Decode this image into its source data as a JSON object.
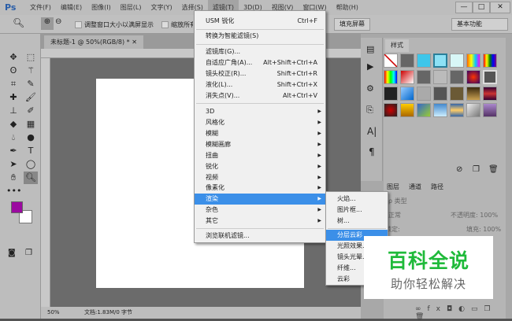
{
  "app": {
    "logo": "Ps"
  },
  "menubar": [
    "文件(F)",
    "编辑(E)",
    "图像(I)",
    "图层(L)",
    "文字(Y)",
    "选择(S)",
    "滤镜(T)",
    "3D(D)",
    "视图(V)",
    "窗口(W)",
    "帮助(H)"
  ],
  "window_controls": {
    "minimize": "—",
    "maximize": "□",
    "close": "✕"
  },
  "options": {
    "resize_windows": "调整窗口大小以满屏显示",
    "zoom_all": "缩放所有窗口",
    "fill_screen": "填充屏幕",
    "workspace": "基本功能"
  },
  "document": {
    "tab": "未标题-1 @ 50%(RGB/8) *",
    "close": "✕"
  },
  "status": {
    "zoom": "50%",
    "doc_info": "文档:1.83M/0 字节"
  },
  "colors": {
    "foreground": "#9b0aa0",
    "background": "#ffffff",
    "menu_highlight": "#3b8fe8"
  },
  "filter_menu": {
    "top": [
      {
        "label": "USM 锐化",
        "shortcut": "Ctrl+F"
      },
      {
        "label": "转换为智能滤镜(S)"
      }
    ],
    "group1": [
      {
        "label": "滤镜库(G)...",
        "shortcut": ""
      },
      {
        "label": "自适应广角(A)...",
        "shortcut": "Alt+Shift+Ctrl+A"
      },
      {
        "label": "镜头校正(R)...",
        "shortcut": "Shift+Ctrl+R"
      },
      {
        "label": "液化(L)...",
        "shortcut": "Shift+Ctrl+X"
      },
      {
        "label": "消失点(V)...",
        "shortcut": "Alt+Ctrl+V"
      }
    ],
    "submenus": [
      "3D",
      "风格化",
      "模糊",
      "模糊画廊",
      "扭曲",
      "锐化",
      "视频",
      "像素化",
      "渲染",
      "杂色",
      "其它"
    ],
    "highlighted": "渲染",
    "browse": "浏览联机滤镜..."
  },
  "render_submenu": {
    "items": [
      "火焰...",
      "图片框...",
      "树..."
    ],
    "items2": [
      "分层云彩",
      "光照效果...",
      "镜头光晕...",
      "纤维...",
      "云彩"
    ],
    "highlighted": "分层云彩"
  },
  "styles_panel": {
    "title": "样式"
  },
  "layers_panel": {
    "tabs": [
      "图层",
      "通道",
      "路径"
    ],
    "filter": "ρ 类型",
    "blend": "正常",
    "opacity": "不透明度: 100%",
    "lock": "锁定:",
    "fill": "填充: 100%"
  },
  "watermark": {
    "title": "百科全说",
    "subtitle": "助你轻松解决"
  }
}
